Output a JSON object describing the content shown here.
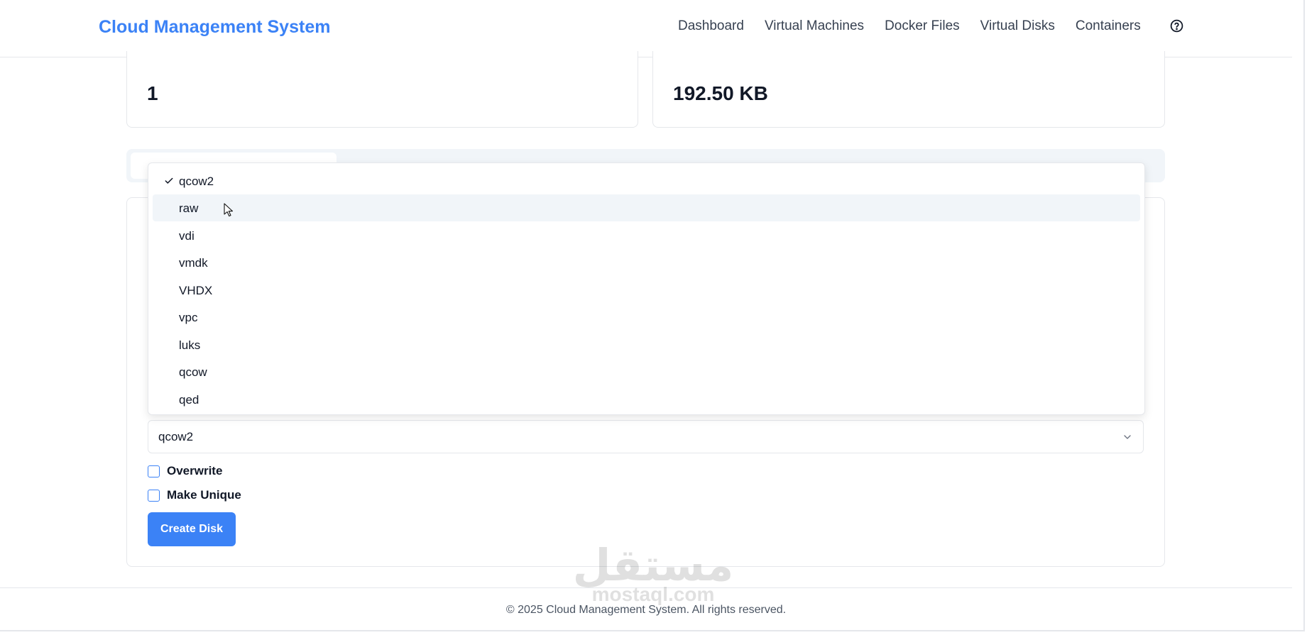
{
  "header": {
    "title": "Cloud Management System",
    "nav": [
      "Dashboard",
      "Virtual Machines",
      "Docker Files",
      "Virtual Disks",
      "Containers"
    ],
    "help_icon": "help-circle-icon"
  },
  "stats": {
    "left_value": "1",
    "right_value": "192.50 KB"
  },
  "format_select": {
    "value": "qcow2",
    "selected_option": "qcow2",
    "hovered_option": "raw",
    "options": [
      "qcow2",
      "raw",
      "vdi",
      "vmdk",
      "VHDX",
      "vpc",
      "luks",
      "qcow",
      "qed"
    ]
  },
  "checkboxes": {
    "overwrite": "Overwrite",
    "make_unique": "Make Unique"
  },
  "create_button": "Create Disk",
  "footer": "© 2025 Cloud Management System. All rights reserved.",
  "watermark": {
    "arabic": "مستقل",
    "latin": "mostaql.com"
  },
  "colors": {
    "accent": "#3b82f6",
    "hover": "#f1f5f9",
    "border": "#e5e7eb"
  }
}
